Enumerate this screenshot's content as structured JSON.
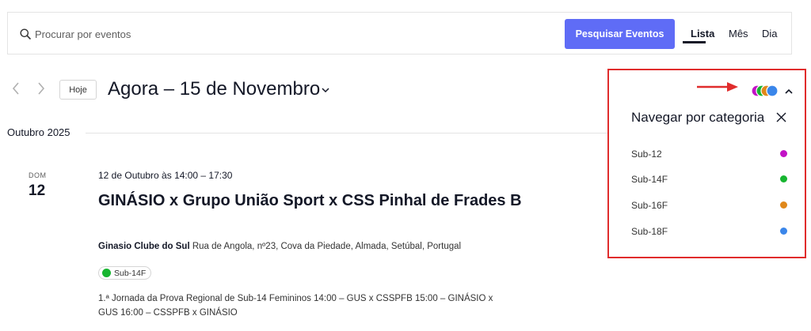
{
  "search": {
    "placeholder": "Procurar por eventos",
    "button_label": "Pesquisar Eventos"
  },
  "views": {
    "list": "Lista",
    "month": "Mês",
    "day": "Dia",
    "active": "Lista"
  },
  "nav": {
    "today_label": "Hoje",
    "date_range": "Agora – 15 de Novembro"
  },
  "month_separator": "Outubro 2025",
  "event": {
    "weekday": "DOM",
    "day": "12",
    "datetime": "12 de Outubro às 14:00 – 17:30",
    "title": "GINÁSIO x Grupo União Sport x CSS Pinhal de Frades B",
    "venue_name": "Ginasio Clube do Sul",
    "venue_address": "Rua de Angola, nº23, Cova da Piedade, Almada, Setúbal, Portugal",
    "category": "Sub-14F",
    "description": "1.ª Jornada da Prova Regional de Sub-14 Femininos 14:00 – GUS x CSSPFB 15:00 – GINÁSIO x GUS 16:00 – CSSPFB x GINÁSIO"
  },
  "category_panel": {
    "heading": "Navegar por categoria",
    "categories": [
      {
        "label": "Sub-12",
        "color": "#c212c6"
      },
      {
        "label": "Sub-14F",
        "color": "#17b530"
      },
      {
        "label": "Sub-16F",
        "color": "#e0881a"
      },
      {
        "label": "Sub-18F",
        "color": "#3a86ea"
      }
    ]
  },
  "colors": {
    "accent": "#5f6cf6",
    "highlight_border": "#e02c2c",
    "text": "#141827"
  }
}
